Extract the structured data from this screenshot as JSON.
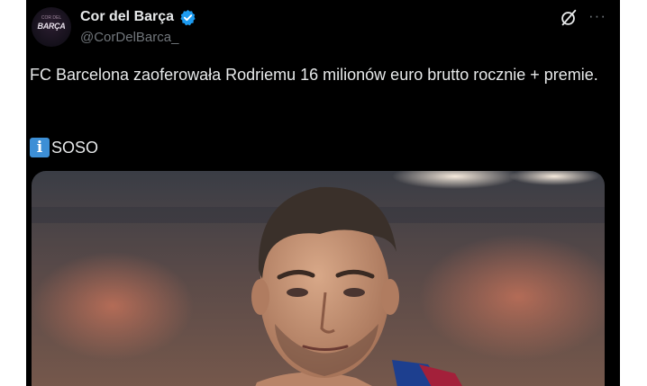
{
  "author": {
    "display_name": "Cor del Barça",
    "handle": "@CorDelBarca_",
    "avatar_text": "BARÇA",
    "avatar_subtext": "COR DEL"
  },
  "tweet": {
    "text": "FC Barcelona zaoferowała Rodriemu 16 milionów euro brutto rocznie + premie.",
    "source_icon": "information-icon",
    "source_icon_glyph": "i",
    "source_label": "SOSO"
  },
  "icons": {
    "verified": "verified-badge-icon",
    "grok": "grok-icon",
    "more": "more-options-icon",
    "more_glyph": "···"
  },
  "colors": {
    "background": "#000000",
    "primary_text": "#e7e9ea",
    "secondary_text": "#71767b",
    "verified": "#1d9bf0",
    "info_icon": "#3d8fd6"
  }
}
